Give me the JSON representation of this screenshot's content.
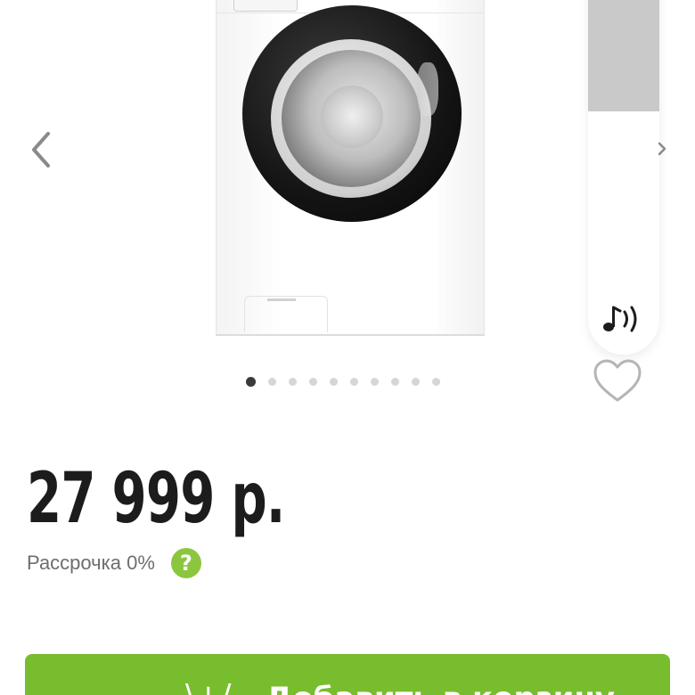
{
  "product": {
    "image_alt": "washing-machine",
    "gallery": {
      "total_slides": 10,
      "active_slide": 1
    }
  },
  "price": {
    "value": "27 999 р."
  },
  "installment": {
    "label": "Рассрочка 0%",
    "help_glyph": "?"
  },
  "actions": {
    "cart_icon": "\\+/",
    "cart_label": "Добавить в корзину"
  },
  "icons": {
    "prev": "chevron-left-icon",
    "next": "chevron-right-icon",
    "sound": "sound-icon",
    "favorite": "heart-icon"
  },
  "colors": {
    "accent_green": "#78bd2e",
    "help_green": "#8cc63f",
    "price_text": "#1c1c1c",
    "muted_text": "#6e6e6e",
    "dot_active": "#3a3a3a",
    "dot_inactive": "#d6d6d6"
  }
}
